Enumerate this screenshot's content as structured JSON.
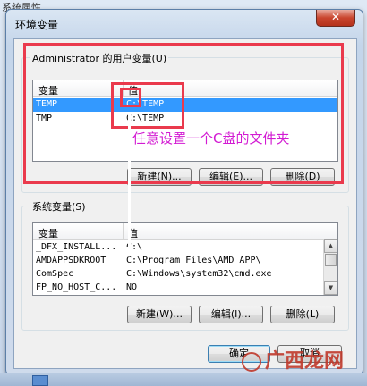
{
  "background_window": {
    "title": "系统属性"
  },
  "dialog": {
    "title": "环境变量",
    "close_symbol": "✕"
  },
  "user_vars": {
    "group_label": "Administrator 的用户变量(U)",
    "columns": [
      "变量",
      "值"
    ],
    "rows": [
      {
        "name": "TEMP",
        "value": "C:\\TEMP",
        "selected": true
      },
      {
        "name": "TMP",
        "value": "C:\\TEMP",
        "selected": false
      }
    ],
    "buttons": {
      "new": "新建(N)...",
      "edit": "编辑(E)...",
      "delete": "删除(D)"
    }
  },
  "system_vars": {
    "group_label": "系统变量(S)",
    "columns": [
      "变量",
      "值"
    ],
    "rows": [
      {
        "name": "_DFX_INSTALL...",
        "value": "C:\\"
      },
      {
        "name": "AMDAPPSDKROOT",
        "value": "C:\\Program Files\\AMD APP\\"
      },
      {
        "name": "ComSpec",
        "value": "C:\\Windows\\system32\\cmd.exe"
      },
      {
        "name": "FP_NO_HOST_C...",
        "value": "NO"
      }
    ],
    "buttons": {
      "new": "新建(W)...",
      "edit": "编辑(I)...",
      "delete": "删除(L)"
    }
  },
  "footer": {
    "ok": "确定",
    "cancel": "取消"
  },
  "annotation": "任意设置一个C盘的文件夹",
  "watermark": "广西龙网",
  "colors": {
    "highlight_box": "#ea3a4d",
    "annotation_text": "#d21ad2",
    "selection": "#3399ff"
  }
}
